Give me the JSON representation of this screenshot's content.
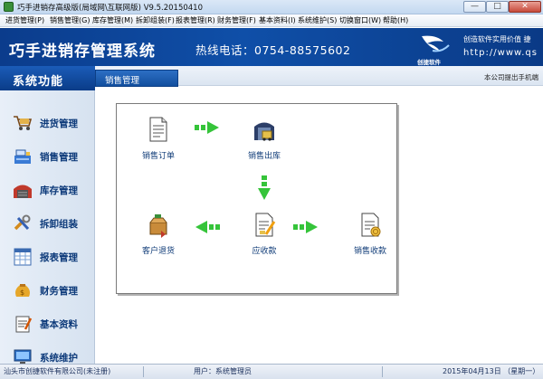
{
  "window": {
    "title": "巧手进销存高级版(局域网\\互联网版) V9.5.20150410",
    "min_glyph": "—",
    "max_glyph": "□",
    "close_glyph": "✕"
  },
  "menu": [
    "进货管理(P)",
    "销售管理(G)",
    "库存管理(M)",
    "拆卸组装(F)",
    "报表管理(R)",
    "财务管理(F)",
    "基本资料(I)",
    "系统维护(S)",
    "切换窗口(W)",
    "帮助(H)"
  ],
  "banner": {
    "system_name": "巧手进销存管理系统",
    "hotline": "热线电话：0754-88575602",
    "brand_name": "创捷软件",
    "slogan": "创造软件实用价值 捷",
    "website": "http://www.qs"
  },
  "sidebar": {
    "header": "系统功能",
    "items": [
      {
        "label": "进货管理",
        "icon": "cart-icon"
      },
      {
        "label": "销售管理",
        "icon": "cashier-icon"
      },
      {
        "label": "库存管理",
        "icon": "warehouse-icon"
      },
      {
        "label": "拆卸组装",
        "icon": "tools-icon"
      },
      {
        "label": "报表管理",
        "icon": "spreadsheet-icon"
      },
      {
        "label": "财务管理",
        "icon": "money-bag-icon"
      },
      {
        "label": "基本资料",
        "icon": "notepad-icon"
      },
      {
        "label": "系统维护",
        "icon": "monitor-icon"
      }
    ]
  },
  "main": {
    "tab": "销售管理",
    "notice": "本公司提出手机端",
    "flow": {
      "sales_order": "销售订单",
      "sales_outbound": "销售出库",
      "customer_return": "客户退货",
      "receivable": "应收款",
      "sales_receipt": "销售收款"
    }
  },
  "status": {
    "company": "汕头市创捷软件有限公司(未注册)",
    "user": "用户：系统管理员",
    "date": "2015年04月13日 （星期一）"
  },
  "colors": {
    "banner_blue": "#0f4fa8",
    "sidebar_text": "#0d3a7a",
    "arrow_green": "#35c43a"
  }
}
